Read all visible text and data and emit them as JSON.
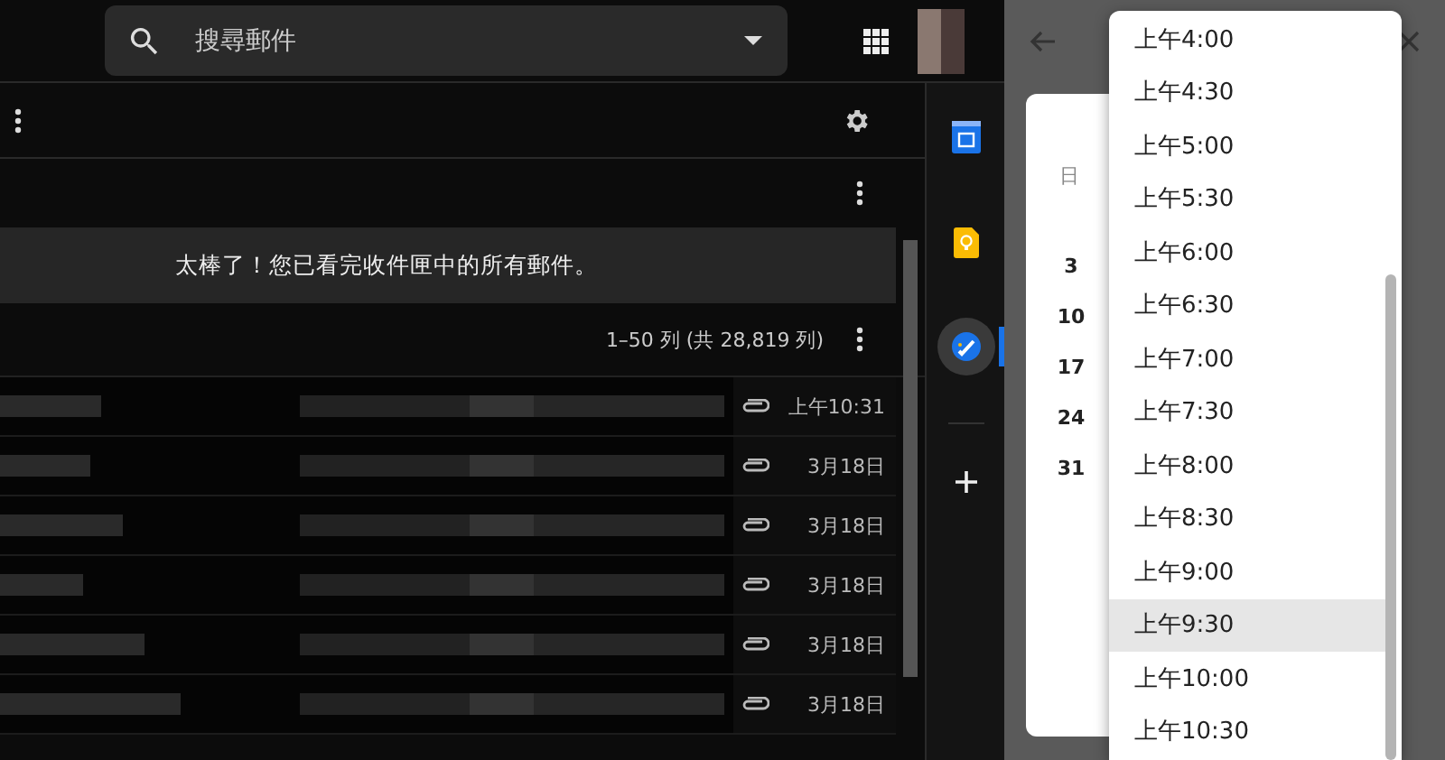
{
  "search": {
    "placeholder": "搜尋郵件"
  },
  "banner": "太棒了！您已看完收件匣中的所有郵件。",
  "pagination": "1–50 列 (共 28,819 列)",
  "mail_rows": [
    {
      "time": "上午10:31",
      "attachment": true
    },
    {
      "time": "3月18日",
      "attachment": true
    },
    {
      "time": "3月18日",
      "attachment": true
    },
    {
      "time": "3月18日",
      "attachment": true
    },
    {
      "time": "3月18日",
      "attachment": true
    },
    {
      "time": "3月18日",
      "attachment": true
    }
  ],
  "addons": [
    {
      "kind": "calendar",
      "selected": false
    },
    {
      "kind": "keep",
      "selected": false
    },
    {
      "kind": "tasks",
      "selected": true
    }
  ],
  "task_panel": {
    "calendar": {
      "weekday": "日",
      "dates": [
        "3",
        "10",
        "17",
        "24",
        "31"
      ]
    },
    "time_menu": [
      {
        "label": "上午4:00",
        "selected": false
      },
      {
        "label": "上午4:30",
        "selected": false
      },
      {
        "label": "上午5:00",
        "selected": false
      },
      {
        "label": "上午5:30",
        "selected": false
      },
      {
        "label": "上午6:00",
        "selected": false
      },
      {
        "label": "上午6:30",
        "selected": false
      },
      {
        "label": "上午7:00",
        "selected": false
      },
      {
        "label": "上午7:30",
        "selected": false
      },
      {
        "label": "上午8:00",
        "selected": false
      },
      {
        "label": "上午8:30",
        "selected": false
      },
      {
        "label": "上午9:00",
        "selected": false
      },
      {
        "label": "上午9:30",
        "selected": true
      },
      {
        "label": "上午10:00",
        "selected": false
      },
      {
        "label": "上午10:30",
        "selected": false
      }
    ]
  }
}
